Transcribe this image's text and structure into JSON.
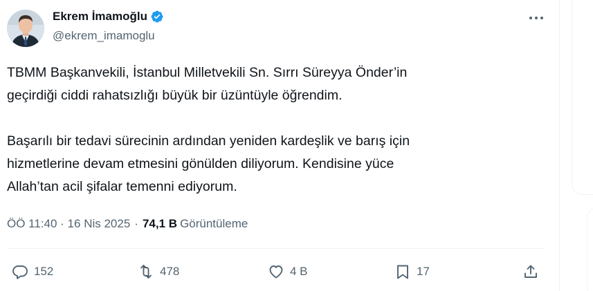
{
  "author": {
    "display_name": "Ekrem İmamoğlu",
    "handle": "@ekrem_imamoglu",
    "verified": true
  },
  "tweet": {
    "text": "TBMM Başkanvekili, İstanbul Milletvekili Sn. Sırrı Süreyya Önder’in\ngeçirdiği ciddi rahatsızlığı büyük bir üzüntüyle öğrendim.\n\nBaşarılı bir tedavi sürecinin ardından yeniden kardeşlik ve barış için\nhizmetlerine devam etmesini gönülden diliyorum. Kendisine yüce\nAllah’tan acil şifalar temenni ediyorum."
  },
  "meta": {
    "time": "ÖÖ 11:40 · 16 Nis 2025",
    "separator": "·",
    "views_count": "74,1 B",
    "views_label": "Görüntüleme"
  },
  "actions": {
    "reply_count": "152",
    "retweet_count": "478",
    "like_count": "4 B",
    "bookmark_count": "17"
  },
  "colors": {
    "text": "#0f1419",
    "secondary": "#536471",
    "verified": "#1d9bf0",
    "divider": "#eff3f4"
  },
  "icons": {
    "more": "more-horizontal-icon",
    "verified": "verified-badge-icon",
    "reply": "reply-icon",
    "retweet": "retweet-icon",
    "like": "heart-icon",
    "bookmark": "bookmark-icon",
    "share": "share-icon"
  }
}
